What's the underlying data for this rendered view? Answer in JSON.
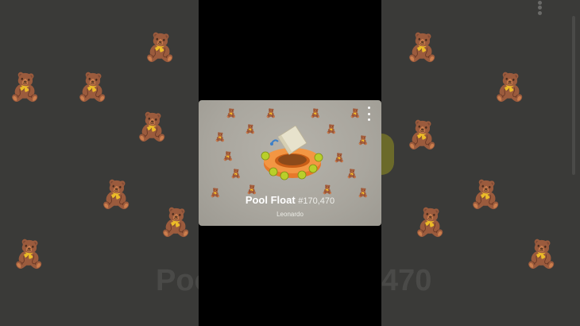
{
  "background": {
    "big_title": "Poo",
    "big_number": "470"
  },
  "card": {
    "gift_name": "Pool Float",
    "gift_number": "#170,470",
    "owner": "Leonardo",
    "more_icon": "more-vertical-icon"
  },
  "colors": {
    "accent_float": "#e8782a",
    "float_balls": "#b9cf2a"
  }
}
